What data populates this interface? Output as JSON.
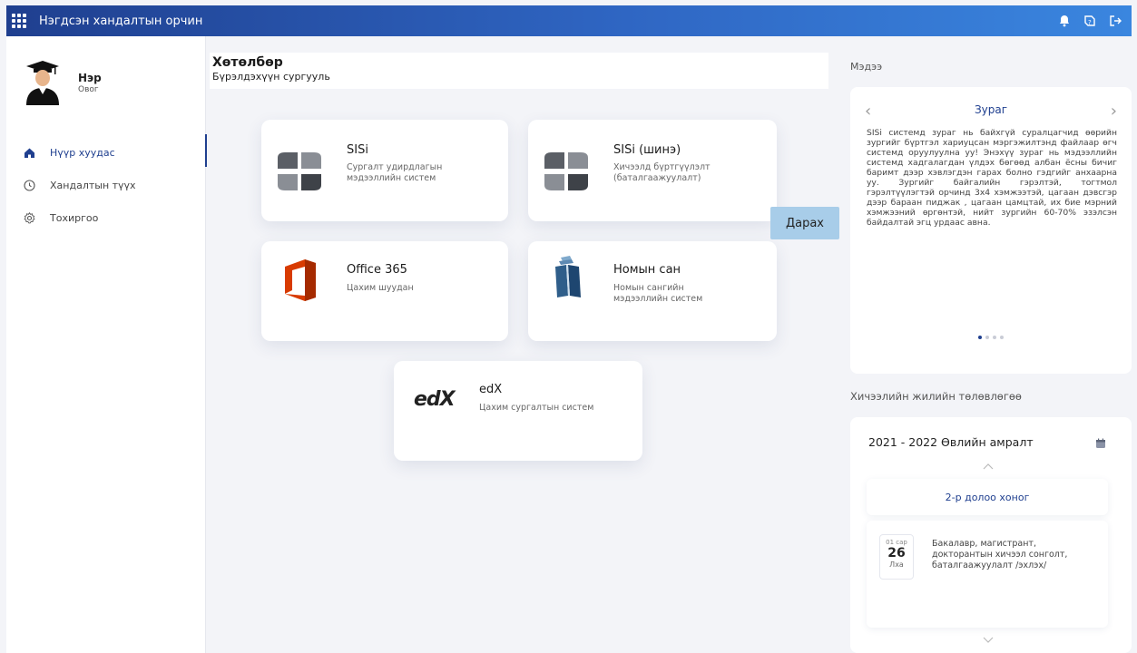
{
  "topbar": {
    "title": "Нэгдсэн хандалтын орчин"
  },
  "profile": {
    "name": "Нэр",
    "sub": "Овог"
  },
  "nav": [
    {
      "label": "Нүүр хуудас",
      "icon": "home-icon",
      "active": true
    },
    {
      "label": "Хандалтын түүх",
      "icon": "clock-icon",
      "active": false
    },
    {
      "label": "Тохиргоо",
      "icon": "gear-icon",
      "active": false
    }
  ],
  "program": {
    "title": "Хөтөлбөр",
    "subtitle": "Бүрэлдэхүүн сургууль"
  },
  "cards": [
    {
      "title": "SISi",
      "desc": "Сургалт удирдлагын мэдээллийн систем",
      "icon": "sisi-logo-icon"
    },
    {
      "title": "SISi (шинэ)",
      "desc": "Хичээлд бүртгүүлэлт (баталгаажуулалт)",
      "icon": "sisi-logo-icon"
    },
    {
      "title": "Office 365",
      "desc": "Цахим шуудан",
      "icon": "office-logo-icon"
    },
    {
      "title": "Номын сан",
      "desc": "Номын сангийн мэдээллийн систем",
      "icon": "library-icon"
    },
    {
      "title": "edX",
      "desc": "Цахим сургалтын систем",
      "icon": "edx-logo-icon",
      "logo_text": "edX"
    }
  ],
  "tooltip": {
    "label": "Дарах"
  },
  "news": {
    "section_label": "Мэдээ",
    "title": "Зураг",
    "body": "SISi системд зураг нь байхгүй суралцагчид өөрийн зургийг бүртгэл хариуцсан мэргэжилтэнд файлаар өгч системд оруулуулна уу! Энэхүү зураг нь мэдээллийн системд хадгалагдан үлдэх бөгөөд албан ёсны бичиг баримт дээр хэвлэгдэн гарах болно гэдгийг анхаарна уу. Зургийг байгалийн гэрэлтэй, тогтмол гэрэлтүүлэгтэй орчинд 3х4 хэмжээтэй, цагаан дэвсгэр дээр бараан пиджак , цагаан цамцтай, их бие мэрний хэмжээний өргөнтэй, нийт зургийн 60-70% эзэлсэн байдалтай эгц урдаас авна.",
    "prev": "‹",
    "next": "›",
    "slides": 4,
    "active_slide": 0
  },
  "plan": {
    "section_label": "Хичээлийн жилийн төлөвлөгөө",
    "title": "2021 - 2022 Өвлийн амралт",
    "week": "2-р долоо хоног",
    "event": {
      "month": "01 сар",
      "day": "26",
      "weekday": "Лха",
      "text": "Бакалавр, магистрант, докторантын хичээл сонголт, баталгаажуулалт /эхлэх/"
    }
  },
  "colors": {
    "primary": "#1f3f8f",
    "accent": "#3a86df",
    "tooltip": "#a8cde9",
    "office": "#d83b01"
  }
}
